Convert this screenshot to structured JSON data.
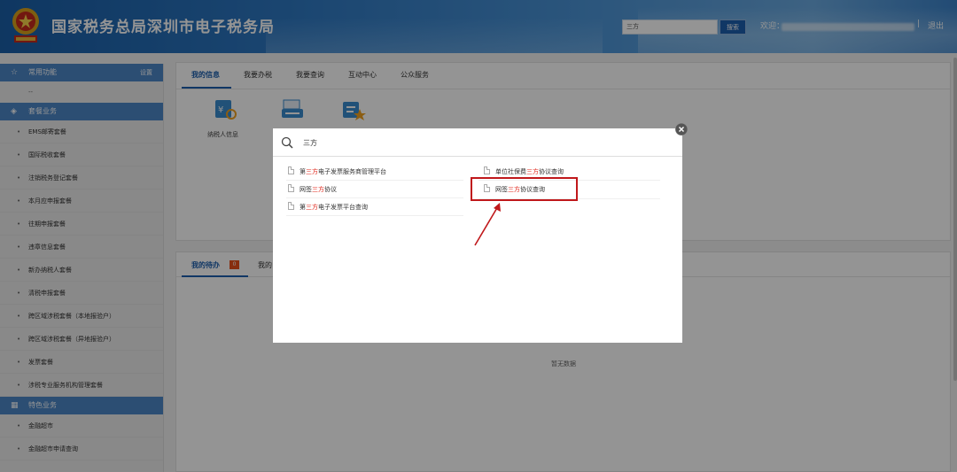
{
  "header": {
    "title": "国家税务总局深圳市电子税务局",
    "search_value": "三方",
    "search_button": "搜索",
    "welcome": "欢迎：",
    "separator": "|",
    "logout": "退出"
  },
  "sidebar": {
    "common_header": {
      "icon": "star-icon",
      "label": "常用功能",
      "settings": "设置"
    },
    "common_items": [
      "--"
    ],
    "package_header": {
      "icon": "layers-icon",
      "label": "套餐业务"
    },
    "package_items": [
      "EMS邮寄套餐",
      "国际税收套餐",
      "注销税务登记套餐",
      "本月应申报套餐",
      "往期申报套餐",
      "违章信息套餐",
      "新办纳税人套餐",
      "清税申报套餐",
      "跨区域涉税套餐（本地报验户）",
      "跨区域涉税套餐（异地报验户）",
      "发票套餐",
      "涉税专业服务机构管理套餐"
    ],
    "special_header": {
      "icon": "grid-icon",
      "label": "特色业务"
    },
    "special_items": [
      "金融超市",
      "金融超市申请查询"
    ]
  },
  "main": {
    "top_tabs": [
      "我的信息",
      "我要办税",
      "我要查询",
      "互动中心",
      "公众服务"
    ],
    "func_label": "纳税人信息",
    "todo_tab": "我的待办",
    "todo_count": "0",
    "other_tab_partial": "我的",
    "empty_text": "暂无数据"
  },
  "modal": {
    "search_value": "三方",
    "results_left": [
      {
        "pre": "第",
        "hl": "三方",
        "post": "电子发票服务商管理平台"
      },
      {
        "pre": "网签",
        "hl": "三方",
        "post": "协议"
      },
      {
        "pre": "第",
        "hl": "三方",
        "post": "电子发票平台查询"
      }
    ],
    "results_right": [
      {
        "pre": "单位社保费",
        "hl": "三方",
        "post": "协议查询"
      },
      {
        "pre": "网签",
        "hl": "三方",
        "post": "协议查询"
      }
    ]
  },
  "colors": {
    "accent": "#1d5fae",
    "sidebar_header": "#4d87c7",
    "highlight": "#e0261a",
    "annotation": "#c0181b"
  }
}
